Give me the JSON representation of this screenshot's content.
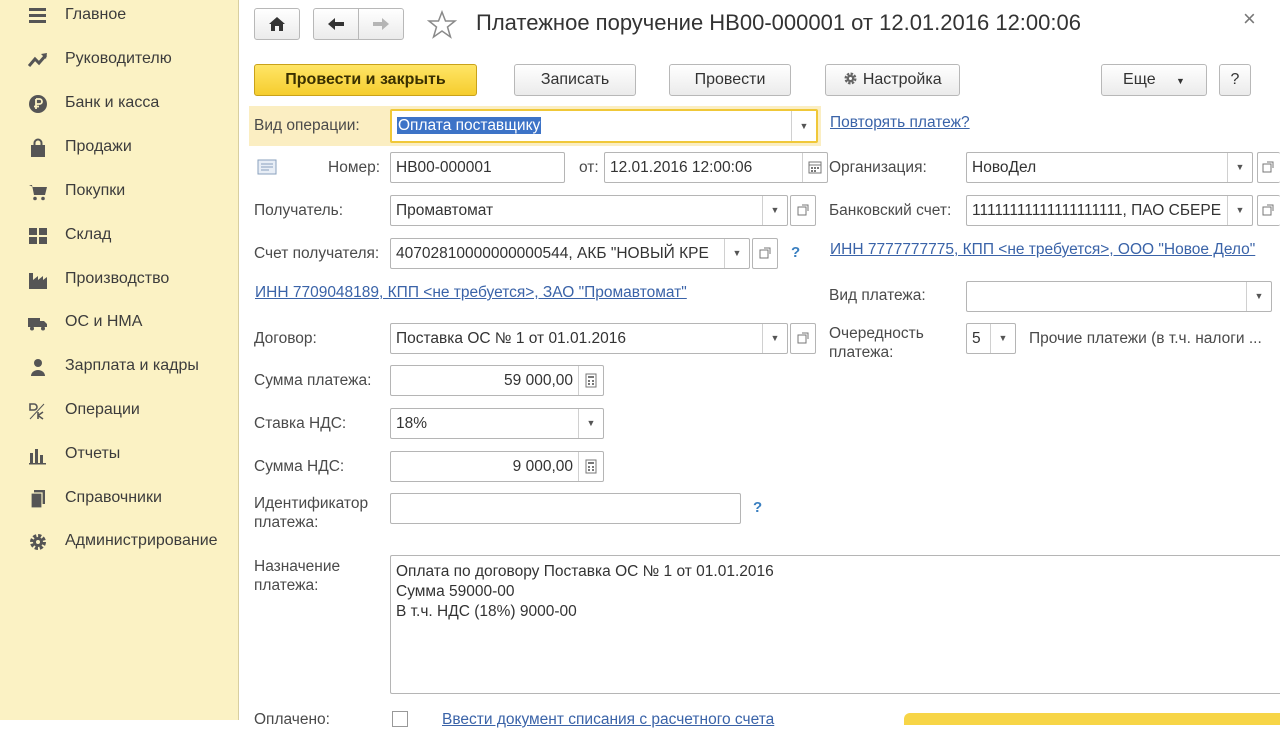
{
  "sidebar": {
    "items": [
      {
        "label": "Главное",
        "icon": "menu-icon"
      },
      {
        "label": "Руководителю",
        "icon": "trend-icon"
      },
      {
        "label": "Банк и касса",
        "icon": "ruble-icon"
      },
      {
        "label": "Продажи",
        "icon": "bag-icon"
      },
      {
        "label": "Покупки",
        "icon": "cart-icon"
      },
      {
        "label": "Склад",
        "icon": "grid-icon"
      },
      {
        "label": "Производство",
        "icon": "factory-icon"
      },
      {
        "label": "ОС и НМА",
        "icon": "truck-icon"
      },
      {
        "label": "Зарплата и кадры",
        "icon": "person-icon"
      },
      {
        "label": "Операции",
        "icon": "debit-credit-icon"
      },
      {
        "label": "Отчеты",
        "icon": "bar-chart-icon"
      },
      {
        "label": "Справочники",
        "icon": "books-icon"
      },
      {
        "label": "Администрирование",
        "icon": "gear-icon"
      }
    ]
  },
  "header": {
    "title": "Платежное поручение НВ00-000001 от 12.01.2016 12:00:06",
    "close": "×"
  },
  "toolbar": {
    "post_and_close": "Провести и закрыть",
    "save": "Записать",
    "post": "Провести",
    "settings": "Настройка",
    "more": "Еще",
    "help": "?"
  },
  "form": {
    "operation_type": {
      "label": "Вид операции:",
      "value": "Оплата поставщику"
    },
    "repeat_payment": "Повторять платеж?",
    "number": {
      "label": "Номер:",
      "value": "НВ00-000001"
    },
    "date": {
      "label": "от:",
      "value": "12.01.2016 12:00:06"
    },
    "organization": {
      "label": "Организация:",
      "value": "НовоДел"
    },
    "recipient": {
      "label": "Получатель:",
      "value": "Промавтомат"
    },
    "bank_account": {
      "label": "Банковский счет:",
      "value": "11111111111111111111, ПАО СБЕРЕ"
    },
    "recipient_account": {
      "label": "Счет получателя:",
      "value": "40702810000000000544, АКБ \"НОВЫЙ КРЕ"
    },
    "help_q": "?",
    "org_link": "ИНН 7777777775, КПП <не требуется>, ООО \"Новое Дело\"",
    "recipient_link": "ИНН 7709048189, КПП <не требуется>, ЗАО \"Промавтомат\"",
    "payment_type": {
      "label": "Вид платежа:",
      "value": ""
    },
    "contract": {
      "label": "Договор:",
      "value": "Поставка ОС № 1 от 01.01.2016"
    },
    "priority": {
      "label": "Очередность платежа:",
      "value": "5",
      "description": "Прочие платежи (в т.ч. налоги ..."
    },
    "amount": {
      "label": "Сумма платежа:",
      "value": "59 000,00"
    },
    "vat_rate": {
      "label": "Ставка НДС:",
      "value": "18%"
    },
    "vat_amount": {
      "label": "Сумма НДС:",
      "value": "9 000,00"
    },
    "payment_id": {
      "label": "Идентификатор платежа:",
      "value": ""
    },
    "purpose": {
      "label": "Назначение платежа:",
      "lines": [
        "Оплата по договору Поставка ОС № 1 от 01.01.2016",
        "Сумма 59000-00",
        "В т.ч. НДС  (18%) 9000-00"
      ]
    },
    "paid": {
      "label": "Оплачено:"
    },
    "write_off_link": "Ввести документ списания с расчетного счета"
  }
}
